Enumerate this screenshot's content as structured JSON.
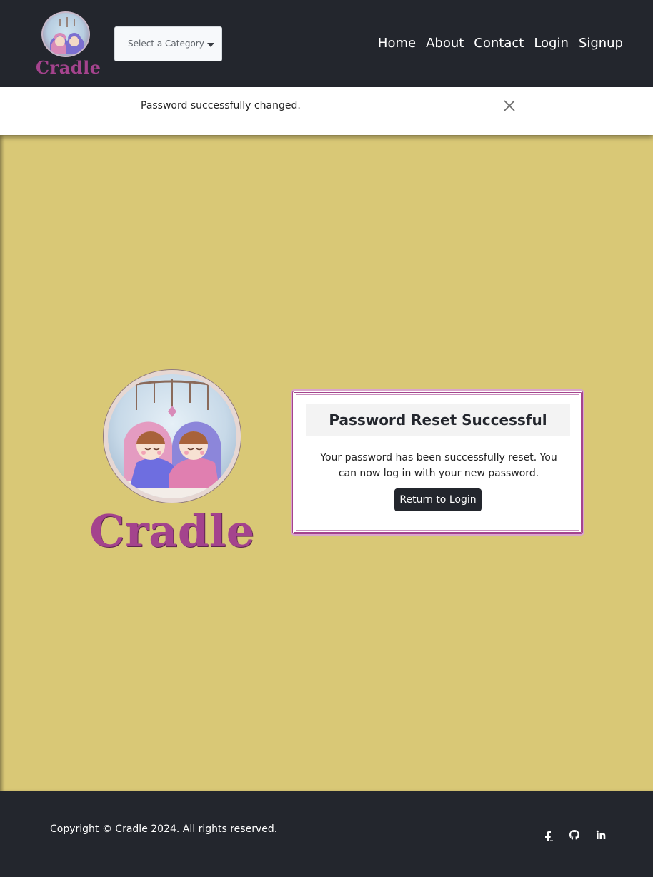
{
  "header": {
    "logo_text": "Cradle",
    "category_placeholder": "Select a Category",
    "nav": [
      "Home",
      "About",
      "Contact",
      "Login",
      "Signup"
    ]
  },
  "alert": {
    "message": "Password successfully changed."
  },
  "main": {
    "logo_text": "Cradle",
    "card": {
      "title": "Password Reset Successful",
      "body": "Your password has been successfully reset. You can now log in with your new password.",
      "button": "Return to Login"
    }
  },
  "footer": {
    "copyright": "Copyright © Cradle 2024. All rights reserved.",
    "social_icons": [
      "facebook-icon",
      "github-icon",
      "linkedin-icon"
    ]
  },
  "colors": {
    "nav_bg": "#23262d",
    "page_bg": "#d9c876",
    "brand": "#a4438d"
  }
}
